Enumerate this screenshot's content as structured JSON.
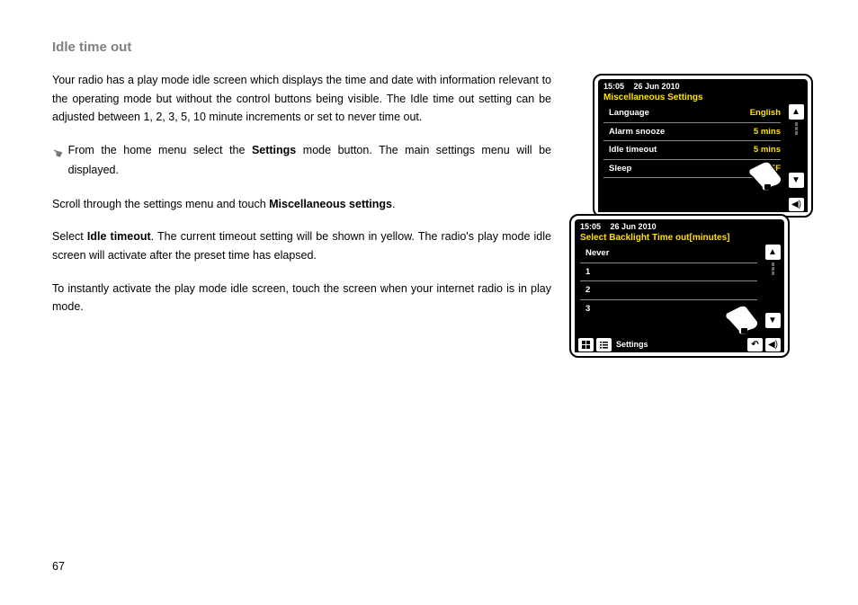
{
  "title": "Idle time out",
  "para1": "Your radio has a play mode idle screen which displays the time and date with information relevant to the operating mode but without the control buttons being visible. The Idle time out setting can be adjusted between 1, 2, 3, 5, 10 minute increments or set to never time out.",
  "indent_pre": "From the home menu select the ",
  "indent_bold": "Settings",
  "indent_post": " mode button. The main settings menu will be displayed.",
  "para2_pre": "Scroll through the settings menu and touch ",
  "para2_bold": "Miscellaneous settings",
  "para2_post": ".",
  "para3_pre": "Select ",
  "para3_bold": "Idle timeout",
  "para3_post": ". The current timeout setting will be shown in yellow. The radio's play mode idle screen will activate after the preset time has elapsed.",
  "para4": "To instantly activate the play mode idle screen, touch the screen when your internet radio is in play mode.",
  "page_number": "67",
  "device1": {
    "time": "15:05",
    "date": "26 Jun 2010",
    "title": "Miscellaneous Settings",
    "rows": [
      {
        "label": "Language",
        "value": "English"
      },
      {
        "label": "Alarm snooze",
        "value": "5 mins"
      },
      {
        "label": "Idle timeout",
        "value": "5 mins"
      },
      {
        "label": "Sleep",
        "value": "OFF"
      }
    ]
  },
  "device2": {
    "time": "15:05",
    "date": "26 Jun 2010",
    "title": "Select Backlight Time out[minutes]",
    "rows": [
      {
        "label": "Never",
        "value": ""
      },
      {
        "label": "1",
        "value": ""
      },
      {
        "label": "2",
        "value": ""
      },
      {
        "label": "3",
        "value": ""
      }
    ],
    "breadcrumb": "Settings"
  }
}
